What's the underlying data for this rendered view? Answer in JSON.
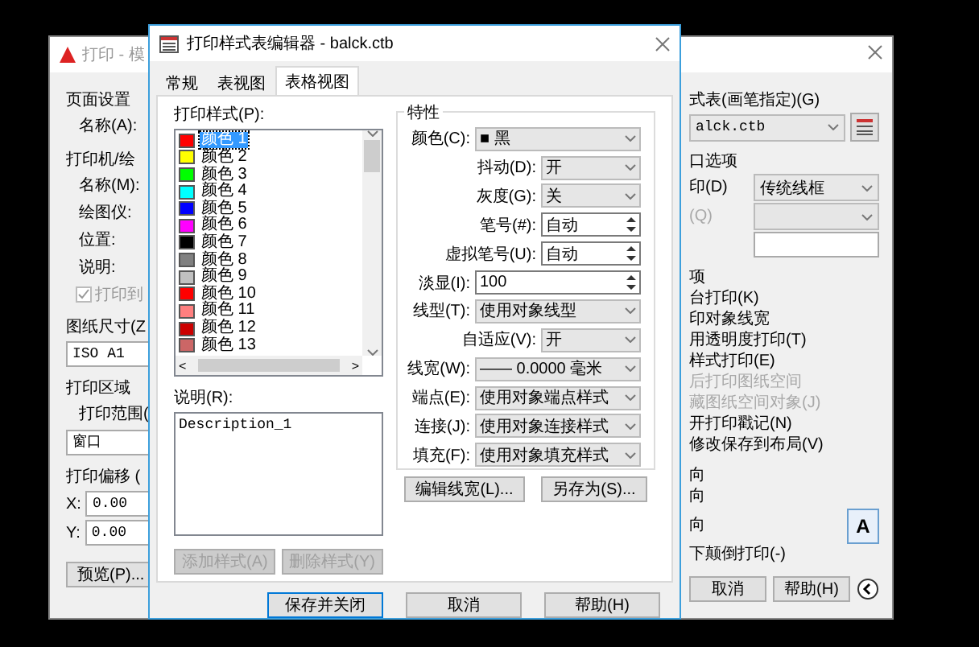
{
  "print_dialog": {
    "title": "打印 - 模",
    "left": [
      {
        "kind": "section",
        "text": "页面设置"
      },
      {
        "kind": "label",
        "text": "名称(A):"
      },
      {
        "kind": "section",
        "text": "打印机/绘"
      },
      {
        "kind": "label",
        "text": "名称(M):"
      },
      {
        "kind": "label",
        "text": "绘图仪:"
      },
      {
        "kind": "label",
        "text": "位置:"
      },
      {
        "kind": "label",
        "text": "说明:"
      },
      {
        "kind": "checkbox",
        "text": "打印到",
        "checked": true
      },
      {
        "kind": "section",
        "text": "图纸尺寸(Z"
      },
      {
        "kind": "field",
        "text": "ISO A1"
      },
      {
        "kind": "section",
        "text": "打印区域"
      },
      {
        "kind": "label",
        "text": "打印范围("
      },
      {
        "kind": "field",
        "text": "窗口"
      },
      {
        "kind": "section",
        "text": "打印偏移 ("
      },
      {
        "kind": "offset",
        "label": "X:",
        "text": "0.00"
      },
      {
        "kind": "offset",
        "label": "Y:",
        "text": "0.00"
      },
      {
        "kind": "button",
        "text": "预览(P)..."
      }
    ],
    "right": [
      {
        "kind": "section",
        "text": "式表(画笔指定)(G)"
      },
      {
        "kind": "table_select",
        "text": "alck.ctb"
      },
      {
        "kind": "section",
        "text": "口选项"
      },
      {
        "kind": "select_row",
        "label": "印(D)",
        "text": "传统线框",
        "disabled": false
      },
      {
        "kind": "select_row",
        "label": "(Q)",
        "disabled": true
      },
      {
        "kind": "blank_field"
      },
      {
        "kind": "section",
        "text": "项"
      },
      {
        "kind": "option",
        "text": "台打印(K)",
        "disabled": false
      },
      {
        "kind": "option",
        "text": "印对象线宽",
        "disabled": false
      },
      {
        "kind": "option",
        "text": "用透明度打印(T)",
        "disabled": false
      },
      {
        "kind": "option",
        "text": "样式打印(E)",
        "disabled": false
      },
      {
        "kind": "option",
        "text": "后打印图纸空间",
        "disabled": true
      },
      {
        "kind": "option",
        "text": "藏图纸空间对象(J)",
        "disabled": true
      },
      {
        "kind": "option",
        "text": "开打印戳记(N)",
        "disabled": false
      },
      {
        "kind": "option",
        "text": "修改保存到布局(V)",
        "disabled": false
      },
      {
        "kind": "section",
        "text": "向"
      },
      {
        "kind": "option",
        "text": "向",
        "disabled": false
      },
      {
        "kind": "orient",
        "text": "向",
        "icon_text": "A"
      },
      {
        "kind": "option",
        "text": "下颠倒打印(-)",
        "disabled": false
      }
    ],
    "buttons": [
      "取消",
      "帮助(H)"
    ]
  },
  "editor": {
    "title": "打印样式表编辑器 - balck.ctb",
    "tabs": [
      {
        "label": "常规",
        "selected": false
      },
      {
        "label": "表视图",
        "selected": false
      },
      {
        "label": "表格视图",
        "selected": true
      }
    ],
    "styles_label": "打印样式(P):",
    "styles": [
      {
        "name": "颜色 1",
        "color": "#ff0000",
        "selected": true
      },
      {
        "name": "颜色 2",
        "color": "#ffff00",
        "selected": false
      },
      {
        "name": "颜色 3",
        "color": "#00ff00",
        "selected": false
      },
      {
        "name": "颜色 4",
        "color": "#00ffff",
        "selected": false
      },
      {
        "name": "颜色 5",
        "color": "#0000ff",
        "selected": false
      },
      {
        "name": "颜色 6",
        "color": "#ff00ff",
        "selected": false
      },
      {
        "name": "颜色 7",
        "color": "#000000",
        "selected": false
      },
      {
        "name": "颜色 8",
        "color": "#808080",
        "selected": false
      },
      {
        "name": "颜色 9",
        "color": "#c0c0c0",
        "selected": false
      },
      {
        "name": "颜色 10",
        "color": "#ff0000",
        "selected": false
      },
      {
        "name": "颜色 11",
        "color": "#ff7f7f",
        "selected": false
      },
      {
        "name": "颜色 12",
        "color": "#cc0000",
        "selected": false
      },
      {
        "name": "颜色 13",
        "color": "#cc6666",
        "selected": false
      }
    ],
    "scroll_left": "<",
    "scroll_right": ">",
    "description_label": "说明(R):",
    "description": "Description_1",
    "list_buttons": [
      {
        "label": "添加样式(A)",
        "disabled": true
      },
      {
        "label": "删除样式(Y)",
        "disabled": true
      }
    ],
    "properties_title": "特性",
    "properties": [
      {
        "label": "颜色(C):",
        "value": "■ 黑",
        "kind": "select",
        "wide": true
      },
      {
        "label": "抖动(D):",
        "value": "开",
        "kind": "select",
        "wide": false
      },
      {
        "label": "灰度(G):",
        "value": "关",
        "kind": "select",
        "wide": false
      },
      {
        "label": "笔号(#):",
        "value": "自动",
        "kind": "spin",
        "wide": false
      },
      {
        "label": "虚拟笔号(U):",
        "value": "自动",
        "kind": "spin",
        "wide": false
      },
      {
        "label": "淡显(I):",
        "value": "100",
        "kind": "spin",
        "wide": true
      },
      {
        "label": "线型(T):",
        "value": "使用对象线型",
        "kind": "select",
        "wide": true
      },
      {
        "label": "自适应(V):",
        "value": "开",
        "kind": "select",
        "wide": false
      },
      {
        "label": "线宽(W):",
        "value": "—— 0.0000 毫米",
        "kind": "select",
        "wide": true
      },
      {
        "label": "端点(E):",
        "value": "使用对象端点样式",
        "kind": "select",
        "wide": true
      },
      {
        "label": "连接(J):",
        "value": "使用对象连接样式",
        "kind": "select",
        "wide": true
      },
      {
        "label": "填充(F):",
        "value": "使用对象填充样式",
        "kind": "select",
        "wide": true
      }
    ],
    "property_buttons": [
      "编辑线宽(L)...",
      "另存为(S)..."
    ],
    "footer_buttons": [
      {
        "label": "保存并关闭",
        "default": true
      },
      {
        "label": "取消",
        "default": false
      },
      {
        "label": "帮助(H)",
        "default": false
      }
    ]
  }
}
